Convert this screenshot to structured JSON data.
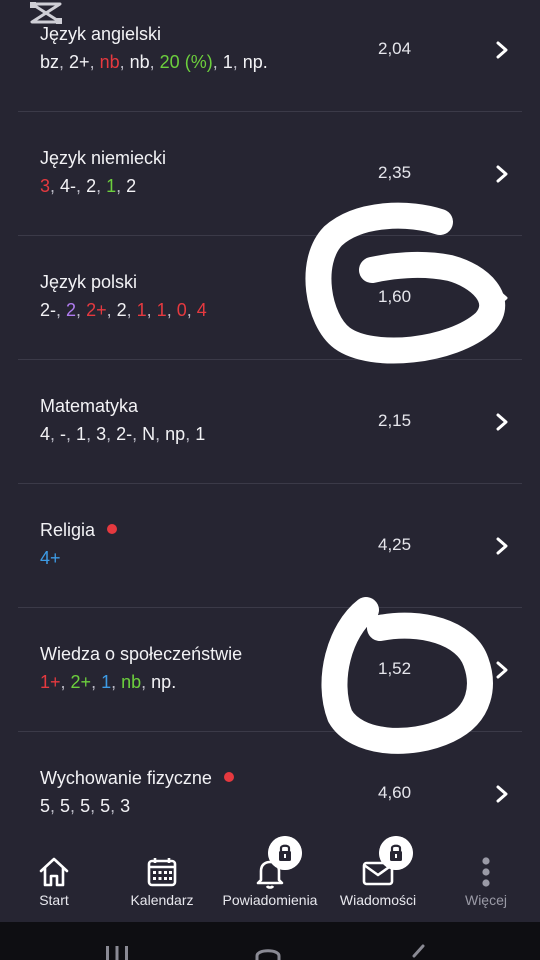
{
  "subjects": [
    {
      "name": "Język angielski",
      "average": "2,04",
      "new": false,
      "grades": [
        {
          "text": "bz",
          "color": "#f2f2f5"
        },
        {
          "text": "2+",
          "color": "#f2f2f5"
        },
        {
          "text": "nb",
          "color": "#e5393f"
        },
        {
          "text": "nb",
          "color": "#f2f2f5"
        },
        {
          "text": "20 (%)",
          "color": "#6ccf3d"
        },
        {
          "text": "1",
          "color": "#f2f2f5"
        },
        {
          "text": "np.",
          "color": "#f2f2f5"
        }
      ]
    },
    {
      "name": "Język niemiecki",
      "average": "2,35",
      "new": false,
      "grades": [
        {
          "text": "3",
          "color": "#e5393f"
        },
        {
          "text": "4-",
          "color": "#f2f2f5"
        },
        {
          "text": "2",
          "color": "#f2f2f5"
        },
        {
          "text": "1",
          "color": "#6ccf3d"
        },
        {
          "text": "2",
          "color": "#f2f2f5"
        }
      ]
    },
    {
      "name": "Język polski",
      "average": "1,60",
      "new": false,
      "grades": [
        {
          "text": "2-",
          "color": "#f2f2f5"
        },
        {
          "text": "2",
          "color": "#b07cf0"
        },
        {
          "text": "2+",
          "color": "#e5393f"
        },
        {
          "text": "2",
          "color": "#f2f2f5"
        },
        {
          "text": "1",
          "color": "#e5393f"
        },
        {
          "text": "1",
          "color": "#e5393f"
        },
        {
          "text": "0",
          "color": "#e5393f"
        },
        {
          "text": "4",
          "color": "#e5393f"
        }
      ]
    },
    {
      "name": "Matematyka",
      "average": "2,15",
      "new": false,
      "grades": [
        {
          "text": "4",
          "color": "#f2f2f5"
        },
        {
          "text": "-",
          "color": "#f2f2f5"
        },
        {
          "text": "1",
          "color": "#f2f2f5"
        },
        {
          "text": "3",
          "color": "#f2f2f5"
        },
        {
          "text": "2-",
          "color": "#f2f2f5"
        },
        {
          "text": "N",
          "color": "#f2f2f5"
        },
        {
          "text": "np",
          "color": "#f2f2f5"
        },
        {
          "text": "1",
          "color": "#f2f2f5"
        }
      ]
    },
    {
      "name": "Religia",
      "average": "4,25",
      "new": true,
      "grades": [
        {
          "text": "4+",
          "color": "#3d9be5"
        }
      ]
    },
    {
      "name": "Wiedza o społeczeństwie",
      "average": "1,52",
      "new": false,
      "grades": [
        {
          "text": "1+",
          "color": "#e5393f"
        },
        {
          "text": "2+",
          "color": "#6ccf3d"
        },
        {
          "text": "1",
          "color": "#3d9be5"
        },
        {
          "text": "nb",
          "color": "#6ccf3d"
        },
        {
          "text": "np.",
          "color": "#f2f2f5"
        }
      ]
    },
    {
      "name": "Wychowanie fizyczne",
      "average": "4,60",
      "new": true,
      "grades": [
        {
          "text": "5",
          "color": "#f2f2f5"
        },
        {
          "text": "5",
          "color": "#f2f2f5"
        },
        {
          "text": "5",
          "color": "#f2f2f5"
        },
        {
          "text": "5",
          "color": "#f2f2f5"
        },
        {
          "text": "3",
          "color": "#f2f2f5"
        }
      ]
    }
  ],
  "nav": {
    "start": "Start",
    "calendar": "Kalendarz",
    "notifications": "Powiadomienia",
    "messages": "Wiadomości",
    "more": "Więcej"
  },
  "icons": {
    "logo": "capcut-logo-icon",
    "chevron": "chevron-right-icon",
    "home": "home-icon",
    "calendar": "calendar-icon",
    "bell": "bell-icon",
    "mail": "mail-icon",
    "more": "vertical-dots-icon",
    "lock": "lock-icon"
  },
  "colors": {
    "background": "#262532",
    "new_dot": "#e5393f"
  }
}
